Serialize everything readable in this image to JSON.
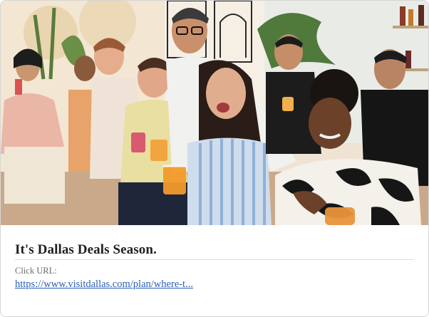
{
  "card": {
    "headline": "It's Dallas Deals Season.",
    "click_label": "Click URL:",
    "click_url_text": "https://www.visitdallas.com/plan/where-t..."
  },
  "hero": {
    "image": "group-of-friends-laughing-with-cocktails"
  },
  "colors": {
    "link": "#2b5fb8",
    "title": "#1f1f1f",
    "label": "#6a6a6a"
  }
}
